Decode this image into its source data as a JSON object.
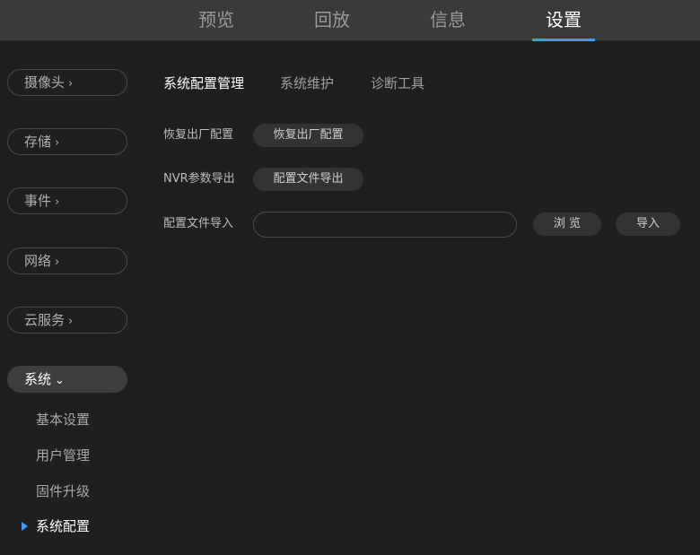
{
  "top_tabs": [
    {
      "label": "预览"
    },
    {
      "label": "回放"
    },
    {
      "label": "信息"
    },
    {
      "label": "设置"
    }
  ],
  "sidebar": {
    "items": [
      {
        "label": "摄像头",
        "chevron": "›"
      },
      {
        "label": "存储",
        "chevron": "›"
      },
      {
        "label": "事件",
        "chevron": "›"
      },
      {
        "label": "网络",
        "chevron": "›"
      },
      {
        "label": "云服务",
        "chevron": "›"
      },
      {
        "label": "系统",
        "chevron": "⌄"
      }
    ],
    "sub_items": [
      {
        "label": "基本设置"
      },
      {
        "label": "用户管理"
      },
      {
        "label": "固件升级"
      },
      {
        "label": "系统配置"
      }
    ]
  },
  "subtabs": [
    {
      "label": "系统配置管理"
    },
    {
      "label": "系统维护"
    },
    {
      "label": "诊断工具"
    }
  ],
  "form": {
    "restore_label": "恢复出厂配置",
    "restore_button": "恢复出厂配置",
    "export_label": "NVR参数导出",
    "export_button": "配置文件导出",
    "import_label": "配置文件导入",
    "import_value": "",
    "browse_button": "浏 览",
    "import_button": "导入"
  },
  "colors": {
    "accent": "#3f9cf0",
    "topbar_bg": "#3a3a3a",
    "page_bg": "#1f1f1f"
  }
}
